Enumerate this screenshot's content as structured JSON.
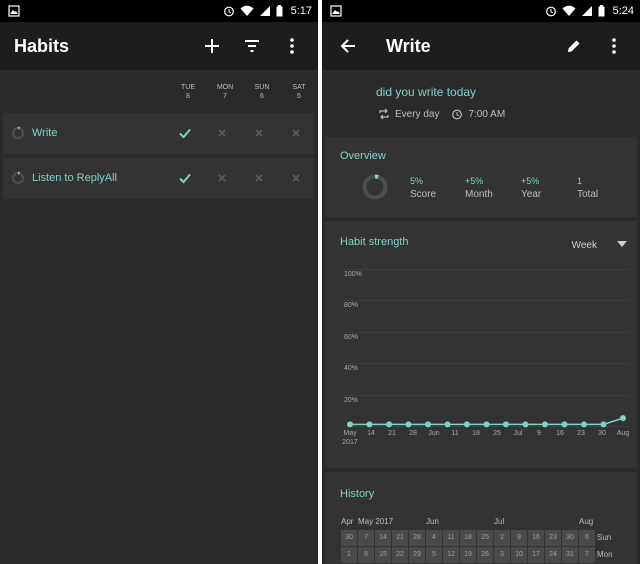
{
  "left": {
    "status": {
      "time": "5:17"
    },
    "appbar": {
      "title": "Habits"
    },
    "days": [
      {
        "name": "TUE",
        "num": "8"
      },
      {
        "name": "MON",
        "num": "7"
      },
      {
        "name": "SUN",
        "num": "6"
      },
      {
        "name": "SAT",
        "num": "5"
      }
    ],
    "habits": [
      {
        "name": "Write",
        "marks": [
          "check",
          "cross",
          "cross",
          "cross"
        ]
      },
      {
        "name": "Listen to ReplyAll",
        "marks": [
          "check",
          "cross",
          "cross",
          "cross"
        ]
      }
    ]
  },
  "right": {
    "status": {
      "time": "5:24"
    },
    "appbar": {
      "title": "Write"
    },
    "question": "did you write today",
    "frequency": "Every day",
    "reminder": "7:00 AM",
    "overview": {
      "title": "Overview",
      "stats": [
        {
          "value": "5%",
          "label": "Score"
        },
        {
          "value": "+5%",
          "label": "Month"
        },
        {
          "value": "+5%",
          "label": "Year"
        },
        {
          "value": "1",
          "label": "Total"
        }
      ]
    },
    "strength": {
      "title": "Habit strength",
      "period": "Week",
      "y_labels": [
        "100%",
        "80%",
        "60%",
        "40%",
        "20%"
      ],
      "x_labels": [
        "May",
        "14",
        "21",
        "28",
        "Jun",
        "11",
        "18",
        "25",
        "Jul",
        "9",
        "16",
        "23",
        "30",
        "Aug"
      ],
      "year_label": "2017"
    },
    "history": {
      "title": "History",
      "months": [
        {
          "label": "Apr",
          "col": 0
        },
        {
          "label": "May 2017",
          "col": 1
        },
        {
          "label": "Jun",
          "col": 5
        },
        {
          "label": "Jul",
          "col": 9
        },
        {
          "label": "Aug",
          "col": 14
        }
      ],
      "row1": [
        "30",
        "7",
        "14",
        "21",
        "28",
        "4",
        "11",
        "18",
        "25",
        "2",
        "9",
        "16",
        "23",
        "30",
        "6"
      ],
      "row2": [
        "1",
        "8",
        "15",
        "22",
        "29",
        "5",
        "12",
        "19",
        "26",
        "3",
        "10",
        "17",
        "24",
        "31",
        "7"
      ],
      "day_labels": [
        "Sun",
        "Mon"
      ]
    }
  },
  "colors": {
    "accent": "#7fd3c6",
    "background": "#2a2a2a",
    "card": "#333333",
    "appbar": "#1d1d1d"
  },
  "chart_data": {
    "type": "line",
    "title": "Habit strength",
    "x": [
      "May 7",
      "May 14",
      "May 21",
      "May 28",
      "Jun 4",
      "Jun 11",
      "Jun 18",
      "Jun 25",
      "Jul 2",
      "Jul 9",
      "Jul 16",
      "Jul 23",
      "Jul 30",
      "Aug 6"
    ],
    "series": [
      {
        "values": [
          1,
          1,
          1,
          1,
          1,
          1,
          1,
          1,
          1,
          1,
          1,
          1,
          1,
          1,
          5
        ]
      }
    ],
    "ylim": [
      0,
      100
    ],
    "grid": true
  }
}
